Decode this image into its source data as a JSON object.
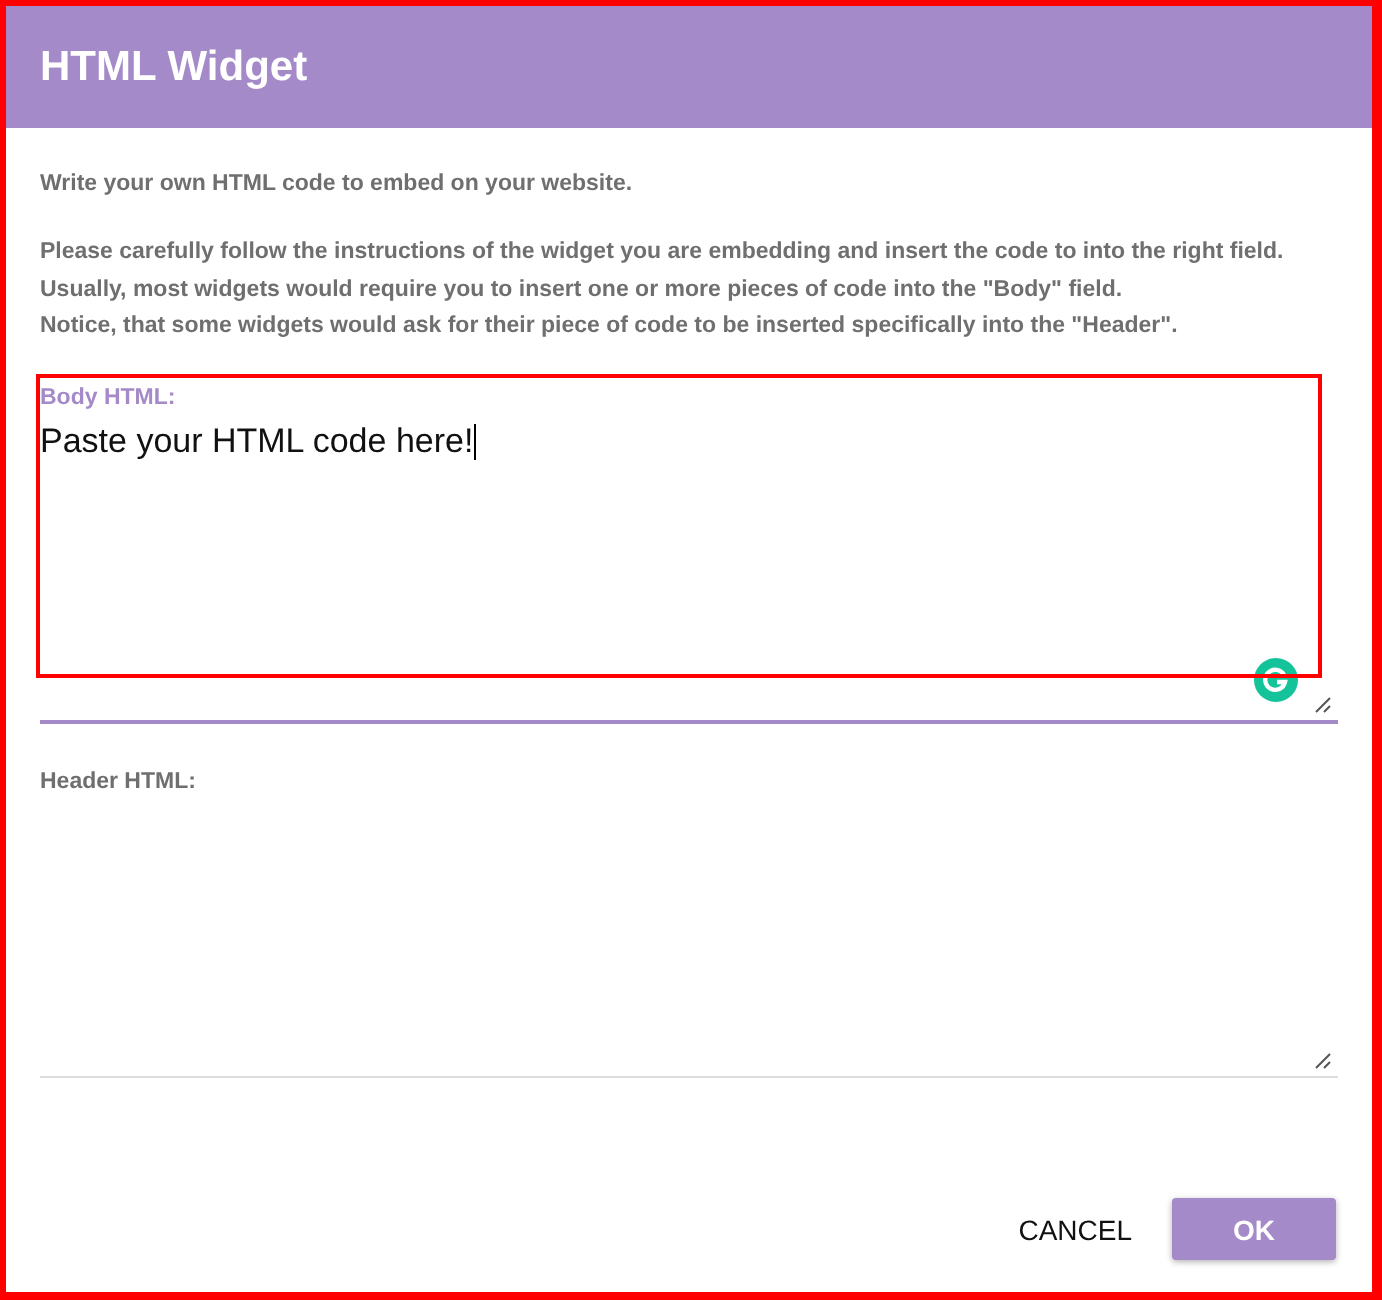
{
  "dialog": {
    "title": "HTML Widget"
  },
  "intro": "Write your own HTML code to embed on your website.",
  "instructions": [
    "Please carefully follow the instructions of the widget you are embedding and insert the code to into the right field.",
    "Usually, most widgets would require you to insert one or more pieces of code into the \"Body\" field.",
    "Notice, that some widgets would ask for their piece of code to be inserted specifically into the \"Header\"."
  ],
  "fields": [
    {
      "label": "Body HTML:",
      "value": "Paste your HTML code here!",
      "focused": true,
      "highlighted": true
    },
    {
      "label": "Header HTML:",
      "focused": false,
      "highlighted": false
    }
  ],
  "buttons": [
    {
      "label": "CANCEL",
      "kind": "flat"
    },
    {
      "label": "OK",
      "kind": "raised"
    }
  ]
}
